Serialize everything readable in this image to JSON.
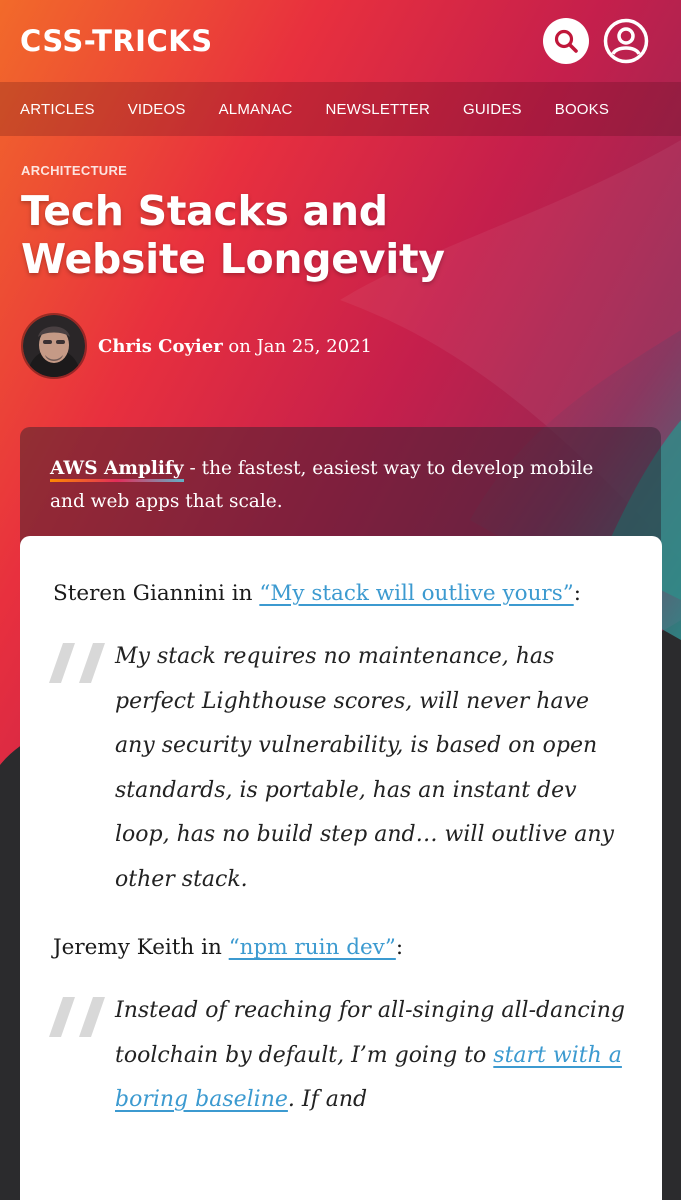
{
  "header": {
    "logo": "CSS-TRICKS",
    "search_icon": "search-icon",
    "user_icon": "user-icon"
  },
  "nav": [
    {
      "label": "ARTICLES"
    },
    {
      "label": "VIDEOS"
    },
    {
      "label": "ALMANAC"
    },
    {
      "label": "NEWSLETTER"
    },
    {
      "label": "GUIDES"
    },
    {
      "label": "BOOKS"
    }
  ],
  "article": {
    "category": "ARCHITECTURE",
    "title": "Tech Stacks and Website Longevity",
    "author": "Chris Coyier",
    "on": " on ",
    "date": "Jan 25, 2021"
  },
  "sponsor": {
    "name": "AWS Amplify",
    "text": " - the fastest, easiest way to develop mobile and web apps that scale."
  },
  "content": {
    "p1_prefix": "Steren Giannini in ",
    "p1_link": "“My stack will outlive yours”",
    "p1_suffix": ":",
    "quote1": "My stack requires no maintenance, has perfect Lighthouse scores, will never have any security vulnerability, is based on open standards, is portable, has an instant dev loop, has no build step and… will outlive any other stack.",
    "p2_prefix": "Jeremy Keith in ",
    "p2_link": "“npm ruin dev”",
    "p2_suffix": ":",
    "quote2_prefix": "Instead of reaching for all-singing all-dancing toolchain by default, I’m going to ",
    "quote2_link": "start with a boring baseline",
    "quote2_suffix": ". If and"
  },
  "colors": {
    "link": "#3c9ad0",
    "hero_orange": "#f05a28",
    "hero_red": "#d81b4a",
    "hero_teal": "#3f8a8c",
    "dark_bg": "#2b2b2d"
  }
}
